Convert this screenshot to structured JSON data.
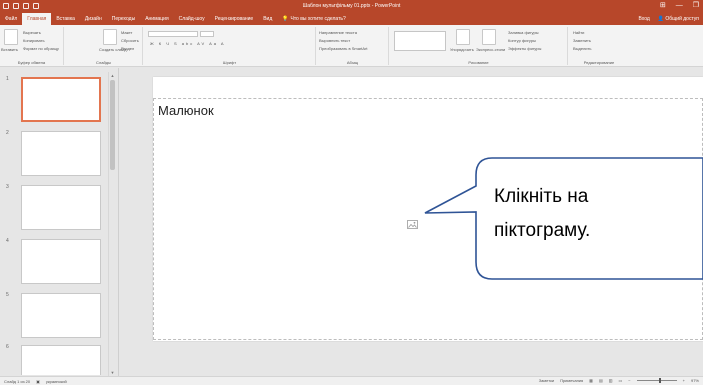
{
  "window": {
    "title": "Шаблон мультфільму 01.pptx - PowerPoint",
    "controls": [
      "⊞",
      "—",
      "❐"
    ]
  },
  "tabs": [
    {
      "label": "Файл"
    },
    {
      "label": "Главная"
    },
    {
      "label": "Вставка"
    },
    {
      "label": "Дизайн"
    },
    {
      "label": "Переходы"
    },
    {
      "label": "Анимация"
    },
    {
      "label": "Слайд-шоу"
    },
    {
      "label": "Рецензирование"
    },
    {
      "label": "Вид"
    }
  ],
  "tell_me": "Что вы хотите сделать?",
  "account": {
    "sign_in": "Вход",
    "share": "Общий доступ"
  },
  "ribbon": {
    "clipboard": {
      "paste": "Вставить",
      "cut": "Вырезать",
      "copy": "Копировать",
      "format": "Формат по образцу",
      "label": "Буфер обмена"
    },
    "slides": {
      "new": "Создать слайд",
      "layout": "Макет",
      "reset": "Сбросить",
      "section": "Раздел",
      "label": "Слайды"
    },
    "font": {
      "label": "Шрифт"
    },
    "paragraph": {
      "direction": "Направление текста",
      "align": "Выровнять текст",
      "smartart": "Преобразовать в SmartArt",
      "label": "Абзац"
    },
    "drawing": {
      "arrange": "Упорядочить",
      "quickstyles": "Экспресс-стили",
      "fill": "Заливка фигуры",
      "outline": "Контур фигуры",
      "effects": "Эффекты фигуры",
      "label": "Рисование"
    },
    "editing": {
      "find": "Найти",
      "replace": "Заменить",
      "select": "Выделить",
      "label": "Редактирование"
    }
  },
  "thumbnails": [
    "1",
    "2",
    "3",
    "4",
    "5",
    "6"
  ],
  "slide": {
    "placeholder_title": "Малюнок",
    "callout_line1": "Клікніть на",
    "callout_line2": "піктограму."
  },
  "status": {
    "slide_info": "Слайд 1 из 20",
    "language": "украинский",
    "notes": "Заметки",
    "comments": "Примечания",
    "zoom": "97%"
  },
  "colors": {
    "accent": "#b7472a",
    "callout_border": "#2f5496",
    "thumb_active": "#e3754f"
  }
}
